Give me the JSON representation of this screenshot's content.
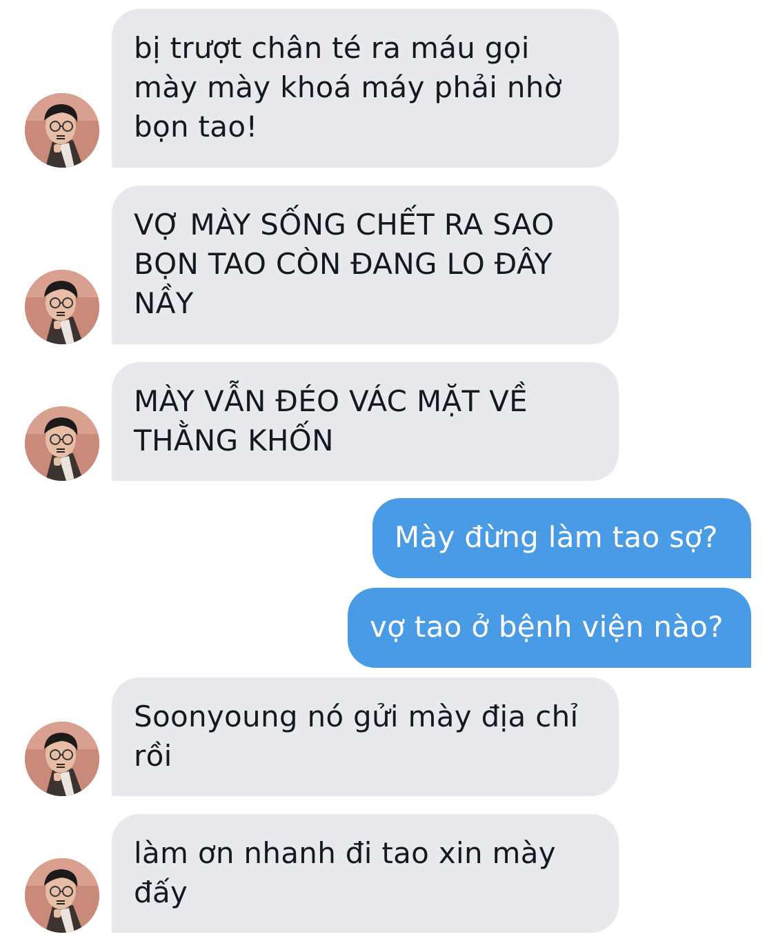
{
  "conversation": {
    "messages": [
      {
        "sender": "contact",
        "text": "bị trượt chân té ra máu gọi\nmày mày khoá máy phải nhờ\nbọn tao!"
      },
      {
        "sender": "contact",
        "text": "VỢ MÀY SỐNG CHẾT RA SAO\nBỌN TAO CÒN ĐANG LO ĐÂY\nNẦY"
      },
      {
        "sender": "contact",
        "text": "MÀY VẪN ĐÉO VÁC MẶT VỀ\nTHẰNG KHỐN"
      },
      {
        "sender": "me",
        "text": "Mày đừng làm tao sợ?"
      },
      {
        "sender": "me",
        "text": "vợ tao ở bệnh viện nào?"
      },
      {
        "sender": "contact",
        "text": "Soonyoung nó gửi mày địa chỉ\nrồi"
      },
      {
        "sender": "contact",
        "text": "làm ơn nhanh đi tao xin mày\nđấy"
      }
    ]
  },
  "colors": {
    "incoming_bubble": "#e7e9ed",
    "incoming_text": "#141823",
    "outgoing_bubble": "#4a9be6",
    "outgoing_text": "#ffffff"
  },
  "icons": {
    "contact_avatar": "contact-avatar-photo"
  }
}
